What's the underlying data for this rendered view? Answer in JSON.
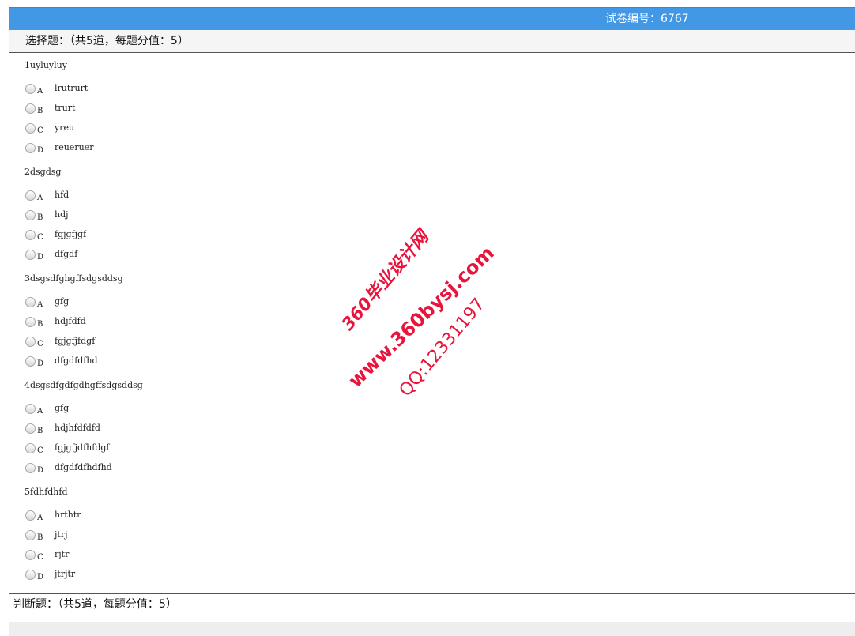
{
  "header": {
    "paper_no": "试卷编号：6767"
  },
  "section_choice": {
    "title": "选择题：（共5道，每题分值：5）"
  },
  "questions": [
    {
      "title": "1uyluyluy",
      "options": [
        {
          "letter": "A",
          "text": "lrutrurt"
        },
        {
          "letter": "B",
          "text": "trurt"
        },
        {
          "letter": "C",
          "text": "yreu"
        },
        {
          "letter": "D",
          "text": "reueruer"
        }
      ]
    },
    {
      "title": "2dsgdsg",
      "options": [
        {
          "letter": "A",
          "text": "hfd"
        },
        {
          "letter": "B",
          "text": "hdj"
        },
        {
          "letter": "C",
          "text": "fgjgfjgf"
        },
        {
          "letter": "D",
          "text": "dfgdf"
        }
      ]
    },
    {
      "title": "3dsgsdfghgffsdgsddsg",
      "options": [
        {
          "letter": "A",
          "text": "gfg"
        },
        {
          "letter": "B",
          "text": "hdjfdfd"
        },
        {
          "letter": "C",
          "text": "fgjgfjfdgf"
        },
        {
          "letter": "D",
          "text": "dfgdfdfhd"
        }
      ]
    },
    {
      "title": "4dsgsdfgdfgdhgffsdgsddsg",
      "options": [
        {
          "letter": "A",
          "text": "gfg"
        },
        {
          "letter": "B",
          "text": "hdjhfdfdfd"
        },
        {
          "letter": "C",
          "text": "fgjgfjdfhfdgf"
        },
        {
          "letter": "D",
          "text": "dfgdfdfhdfhd"
        }
      ]
    },
    {
      "title": "5fdhfdhfd",
      "options": [
        {
          "letter": "A",
          "text": "hrthtr"
        },
        {
          "letter": "B",
          "text": "jtrj"
        },
        {
          "letter": "C",
          "text": "rjtr"
        },
        {
          "letter": "D",
          "text": "jtrjtr"
        }
      ]
    }
  ],
  "section_judge": {
    "title": "判断题：（共5道，每题分值：5）"
  },
  "watermark": {
    "line1": "360毕业设计网",
    "line2": "www.360bysj.com",
    "line3": "QQ:12331197"
  },
  "colors": {
    "header_bg": "#4398e6",
    "watermark": "#e8143c"
  }
}
